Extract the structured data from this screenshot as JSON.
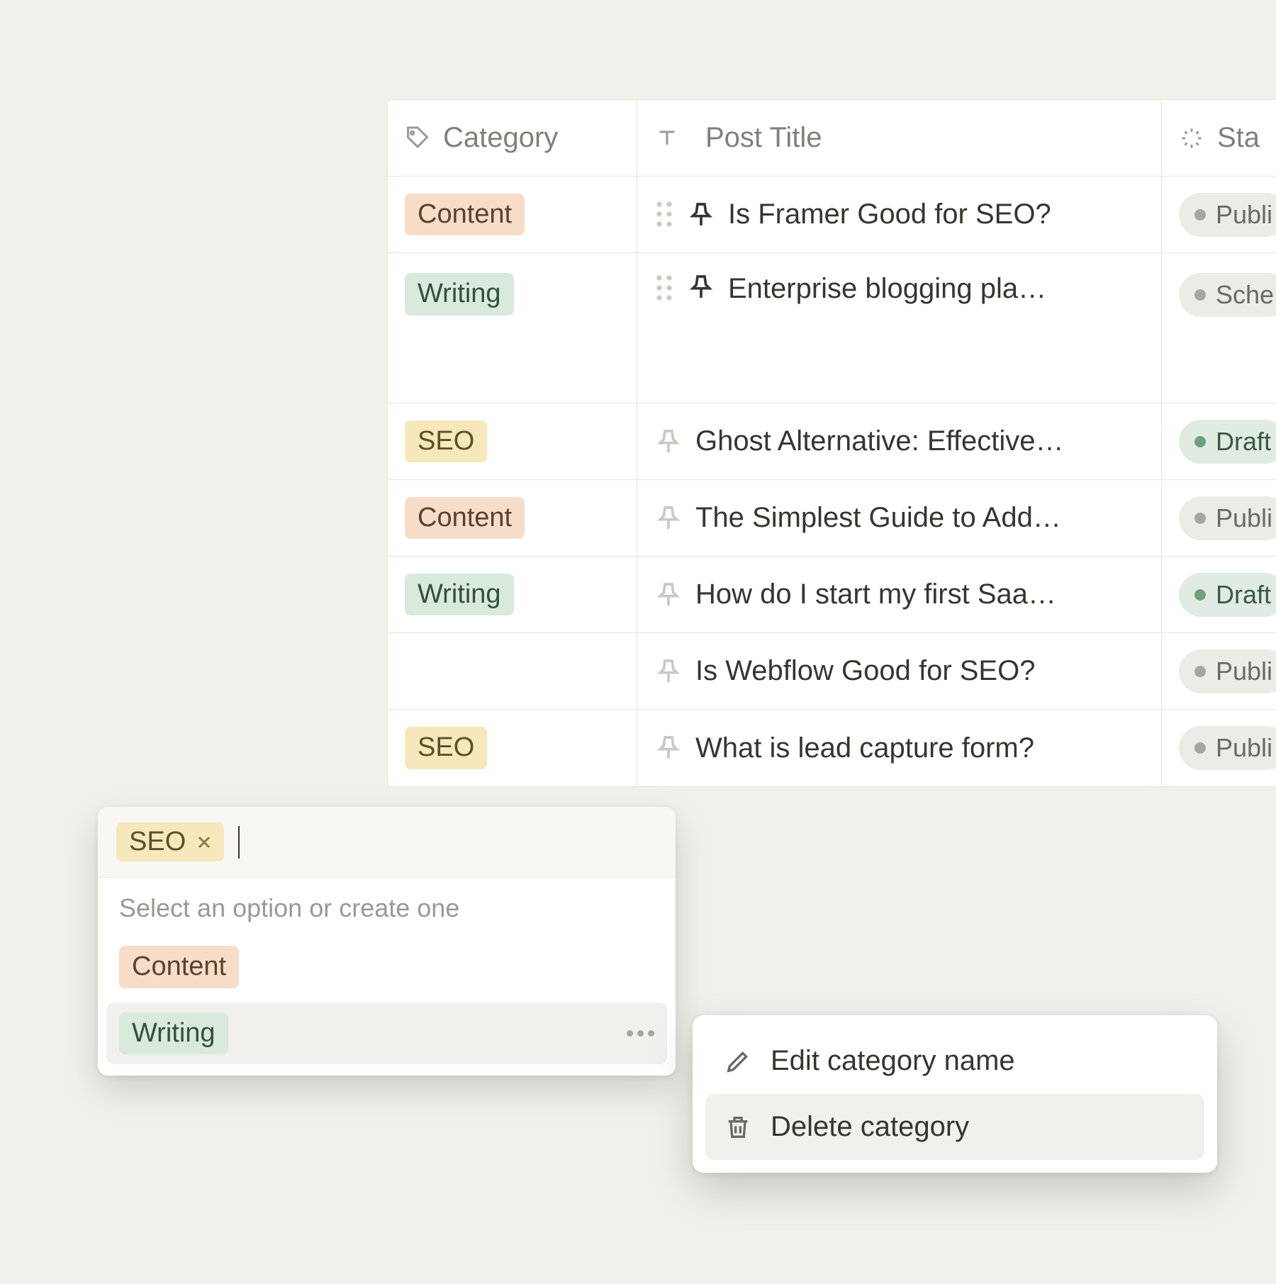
{
  "columns": {
    "category": "Category",
    "title": "Post Title",
    "status": "Sta"
  },
  "categoryStyles": {
    "Content": "content",
    "Writing": "writing",
    "SEO": "seo"
  },
  "rows": [
    {
      "category": "Content",
      "title": "Is Framer Good for SEO?",
      "pinned": true,
      "drag": true,
      "status": "Publi",
      "statusStyle": "default",
      "tall": false
    },
    {
      "category": "Writing",
      "title": "Enterprise blogging pla…",
      "pinned": true,
      "drag": true,
      "status": "Sche",
      "statusStyle": "default",
      "tall": true
    },
    {
      "category": "SEO",
      "title": "Ghost Alternative: Effective…",
      "pinned": false,
      "drag": false,
      "status": "Draft",
      "statusStyle": "draft",
      "tall": false
    },
    {
      "category": "Content",
      "title": "The Simplest Guide to Add…",
      "pinned": false,
      "drag": false,
      "status": "Publi",
      "statusStyle": "default",
      "tall": false
    },
    {
      "category": "Writing",
      "title": "How do I start my first Saa…",
      "pinned": false,
      "drag": false,
      "status": "Draft",
      "statusStyle": "draft",
      "tall": false
    },
    {
      "category": "",
      "title": "Is Webflow Good for SEO?",
      "pinned": false,
      "drag": false,
      "status": "Publi",
      "statusStyle": "default",
      "tall": false
    },
    {
      "category": "SEO",
      "title": "What is lead capture form?",
      "pinned": false,
      "drag": false,
      "status": "Publi",
      "statusStyle": "default",
      "tall": false
    }
  ],
  "picker": {
    "chip": "SEO",
    "hint": "Select an option or create one",
    "options": [
      {
        "label": "Content",
        "style": "content",
        "hover": false
      },
      {
        "label": "Writing",
        "style": "writing",
        "hover": true
      }
    ]
  },
  "contextMenu": {
    "edit": "Edit category name",
    "delete": "Delete category"
  }
}
